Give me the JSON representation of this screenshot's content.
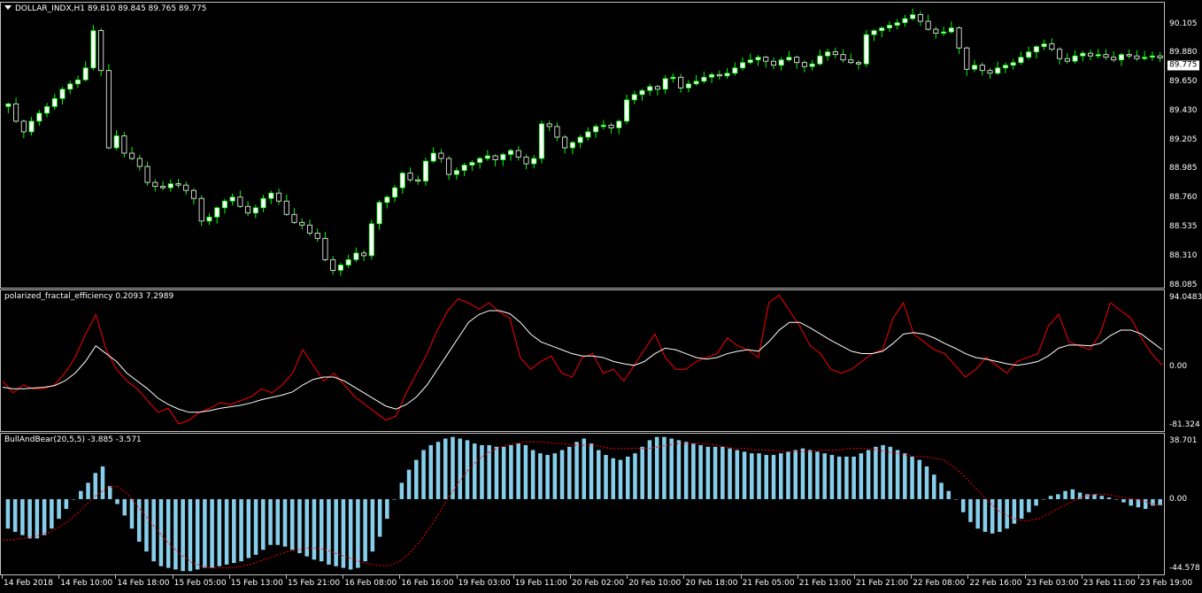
{
  "main": {
    "title": "DOLLAR_INDX,H1  89.810 89.845 89.765 89.775",
    "current_price": "89.775",
    "y_labels": [
      "90.105",
      "89.880",
      "89.650",
      "89.430",
      "89.205",
      "88.985",
      "88.760",
      "88.535",
      "88.310",
      "88.085"
    ],
    "y_range": [
      88.05,
      90.19
    ]
  },
  "pfe": {
    "title": "polarized_fractal_efficiency 0.2093 7.2989",
    "y_labels": [
      "94.0483",
      "0.00",
      "-81.324"
    ],
    "y_range": [
      -84,
      96
    ],
    "colors": {
      "pfe": "#ff0000",
      "signal": "#ffffff"
    }
  },
  "bb": {
    "title": "BullAndBear(20,5,5) -3.885 -3.571",
    "y_labels": [
      "38.701",
      "0.00",
      "-44.578"
    ],
    "y_range": [
      -46,
      40
    ],
    "colors": {
      "hist": "#87ceeb",
      "signal": "#ff0000"
    }
  },
  "x_labels": [
    "14 Feb 2018",
    "14 Feb 10:00",
    "14 Feb 18:00",
    "15 Feb 05:00",
    "15 Feb 13:00",
    "15 Feb 21:00",
    "16 Feb 08:00",
    "16 Feb 16:00",
    "19 Feb 03:00",
    "19 Feb 11:00",
    "20 Feb 02:00",
    "20 Feb 10:00",
    "20 Feb 18:00",
    "21 Feb 05:00",
    "21 Feb 13:00",
    "21 Feb 21:00",
    "22 Feb 08:00",
    "22 Feb 16:00",
    "23 Feb 03:00",
    "23 Feb 11:00",
    "23 Feb 19:00"
  ],
  "colors": {
    "bull": "#ffffff",
    "bear": "#ffffff",
    "wick": "#00ff00",
    "background": "#000000",
    "grid": "#c0c0c0"
  },
  "chart_data": [
    {
      "type": "candlestick",
      "title": "DOLLAR_INDX,H1",
      "ylim": [
        88.085,
        90.105
      ],
      "close_path": [
        89.43,
        89.3,
        89.22,
        89.3,
        89.36,
        89.41,
        89.47,
        89.54,
        89.58,
        89.61,
        89.7,
        89.98,
        89.68,
        89.1,
        89.19,
        89.06,
        89.02,
        88.96,
        88.84,
        88.81,
        88.8,
        88.83,
        88.82,
        88.78,
        88.72,
        88.55,
        88.58,
        88.65,
        88.7,
        88.73,
        88.66,
        88.61,
        88.65,
        88.72,
        88.76,
        88.7,
        88.6,
        88.54,
        88.52,
        88.46,
        88.42,
        88.26,
        88.18,
        88.22,
        88.26,
        88.31,
        88.29,
        88.53,
        88.69,
        88.73,
        88.8,
        88.91,
        88.86,
        88.85,
        89.0,
        89.06,
        89.02,
        88.9,
        88.93,
        88.97,
        88.99,
        89.02,
        89.04,
        89.01,
        89.05,
        89.08,
        89.03,
        88.98,
        89.02,
        89.28,
        89.26,
        89.18,
        89.1,
        89.14,
        89.18,
        89.22,
        89.26,
        89.27,
        89.25,
        89.3,
        89.46,
        89.5,
        89.53,
        89.56,
        89.54,
        89.62,
        89.63,
        89.55,
        89.58,
        89.6,
        89.63,
        89.65,
        89.64,
        89.66,
        89.7,
        89.74,
        89.76,
        89.78,
        89.75,
        89.72,
        89.76,
        89.78,
        89.74,
        89.71,
        89.73,
        89.79,
        89.82,
        89.8,
        89.76,
        89.74,
        89.73,
        89.95,
        89.98,
        90.0,
        90.02,
        90.04,
        90.07,
        90.1,
        90.05,
        89.99,
        89.96,
        89.97,
        90.0,
        89.85,
        89.69,
        89.72,
        89.68,
        89.66,
        89.7,
        89.72,
        89.74,
        89.78,
        89.82,
        89.86,
        89.88,
        89.84,
        89.77,
        89.75,
        89.79,
        89.81,
        89.79,
        89.8,
        89.78,
        89.76,
        89.8,
        89.79,
        89.77,
        89.78,
        89.79,
        89.775
      ]
    },
    {
      "type": "line",
      "title": "polarized_fractal_efficiency",
      "ylim": [
        -81.324,
        94.0483
      ],
      "series": [
        {
          "name": "",
          "values": [
            -20,
            -35,
            -25,
            -30,
            -30,
            -25,
            -10,
            10,
            40,
            65,
            20,
            -5,
            -20,
            -30,
            -45,
            -60,
            -55,
            -75,
            -70,
            -60,
            -55,
            -48,
            -50,
            -45,
            -40,
            -30,
            -35,
            -25,
            -10,
            20,
            0,
            -20,
            -10,
            -25,
            -40,
            -50,
            -60,
            -70,
            -65,
            -35,
            -10,
            15,
            45,
            70,
            85,
            80,
            72,
            80,
            68,
            60,
            10,
            -5,
            5,
            12,
            -10,
            -15,
            10,
            15,
            -10,
            -5,
            -20,
            0,
            20,
            40,
            10,
            -5,
            -5,
            5,
            10,
            15,
            35,
            25,
            20,
            10,
            80,
            90,
            70,
            50,
            25,
            15,
            -5,
            -10,
            -5,
            5,
            15,
            20,
            60,
            80,
            40,
            30,
            20,
            15,
            0,
            -15,
            -5,
            10,
            0,
            -10,
            5,
            10,
            15,
            50,
            65,
            30,
            25,
            20,
            40,
            80,
            70,
            60,
            35,
            15,
            0
          ]
        },
        {
          "name": "",
          "values": [
            -28,
            -30,
            -30,
            -29,
            -28,
            -26,
            -20,
            -10,
            5,
            25,
            15,
            5,
            -10,
            -20,
            -30,
            -42,
            -50,
            -56,
            -60,
            -60,
            -58,
            -55,
            -53,
            -51,
            -48,
            -44,
            -41,
            -38,
            -34,
            -25,
            -18,
            -15,
            -15,
            -20,
            -28,
            -36,
            -44,
            -52,
            -56,
            -50,
            -40,
            -25,
            -5,
            15,
            35,
            55,
            65,
            70,
            70,
            66,
            55,
            40,
            30,
            25,
            20,
            15,
            12,
            12,
            10,
            5,
            2,
            0,
            5,
            15,
            22,
            20,
            15,
            10,
            8,
            10,
            15,
            18,
            20,
            18,
            30,
            45,
            55,
            55,
            48,
            40,
            32,
            25,
            18,
            15,
            15,
            18,
            28,
            40,
            42,
            40,
            35,
            28,
            22,
            15,
            10,
            8,
            5,
            2,
            0,
            2,
            5,
            12,
            22,
            26,
            26,
            25,
            28,
            38,
            45,
            45,
            40,
            30,
            20
          ]
        }
      ]
    },
    {
      "type": "bar",
      "title": "BullAndBear(20,5,5)",
      "ylim": [
        -44.578,
        38.701
      ],
      "series": [
        {
          "name": "",
          "values": [
            -18,
            -20,
            -22,
            -24,
            -24,
            -22,
            -18,
            -12,
            -6,
            0,
            5,
            10,
            16,
            20,
            8,
            -3,
            -10,
            -18,
            -26,
            -32,
            -38,
            -41,
            -42,
            -43,
            -44,
            -44,
            -43,
            -42,
            -42,
            -41,
            -40,
            -39,
            -38,
            -36,
            -34,
            -31,
            -28,
            -28,
            -29,
            -31,
            -33,
            -35,
            -37,
            -38,
            -40,
            -41,
            -42,
            -43,
            -42,
            -38,
            -32,
            -23,
            -12,
            0,
            10,
            18,
            24,
            30,
            33,
            35,
            37,
            38,
            37,
            36,
            34,
            33,
            33,
            32,
            32,
            33,
            34,
            33,
            30,
            28,
            27,
            28,
            30,
            32,
            35,
            37,
            34,
            30,
            27,
            25,
            24,
            26,
            28,
            32,
            36,
            38,
            38,
            37,
            36,
            35,
            34,
            33,
            32,
            32,
            32,
            31,
            30,
            29,
            28,
            28,
            27,
            27,
            28,
            29,
            30,
            31,
            30,
            29,
            28,
            27,
            26,
            26,
            26,
            28,
            30,
            32,
            33,
            32,
            30,
            28,
            26,
            24,
            20,
            15,
            10,
            5,
            0,
            -8,
            -14,
            -18,
            -20,
            -21,
            -20,
            -18,
            -15,
            -12,
            -8,
            -4,
            0,
            2,
            3,
            5,
            6,
            4,
            3,
            3,
            2,
            1,
            0,
            -2,
            -4,
            -5,
            -6,
            -4,
            -3.885
          ]
        },
        {
          "name": "",
          "values": [
            -25,
            -25,
            -24,
            -23,
            -22,
            -20,
            -17,
            -13,
            -8,
            -2,
            3,
            7,
            8,
            4,
            -3,
            -10,
            -17,
            -24,
            -30,
            -35,
            -39,
            -41,
            -42,
            -42,
            -42,
            -41,
            -40,
            -38,
            -36,
            -34,
            -32,
            -31,
            -30,
            -30,
            -31,
            -33,
            -35,
            -37,
            -39,
            -40,
            -41,
            -40,
            -37,
            -32,
            -25,
            -17,
            -8,
            2,
            10,
            18,
            24,
            28,
            31,
            33,
            34,
            35,
            35,
            35,
            34,
            34,
            33,
            33,
            33,
            32,
            31,
            31,
            31,
            31,
            31,
            32,
            33,
            34,
            34,
            34,
            34,
            33,
            32,
            31,
            31,
            30,
            30,
            30,
            29,
            29,
            29,
            29,
            30,
            30,
            30,
            31,
            31,
            31,
            30,
            29,
            28,
            27,
            26,
            26,
            25,
            24,
            20,
            15,
            9,
            3,
            -3,
            -8,
            -11,
            -13,
            -13,
            -12,
            -9,
            -6,
            -3,
            0,
            2,
            3,
            3,
            2,
            1,
            0,
            -1,
            -3,
            -3.571
          ]
        }
      ]
    }
  ]
}
